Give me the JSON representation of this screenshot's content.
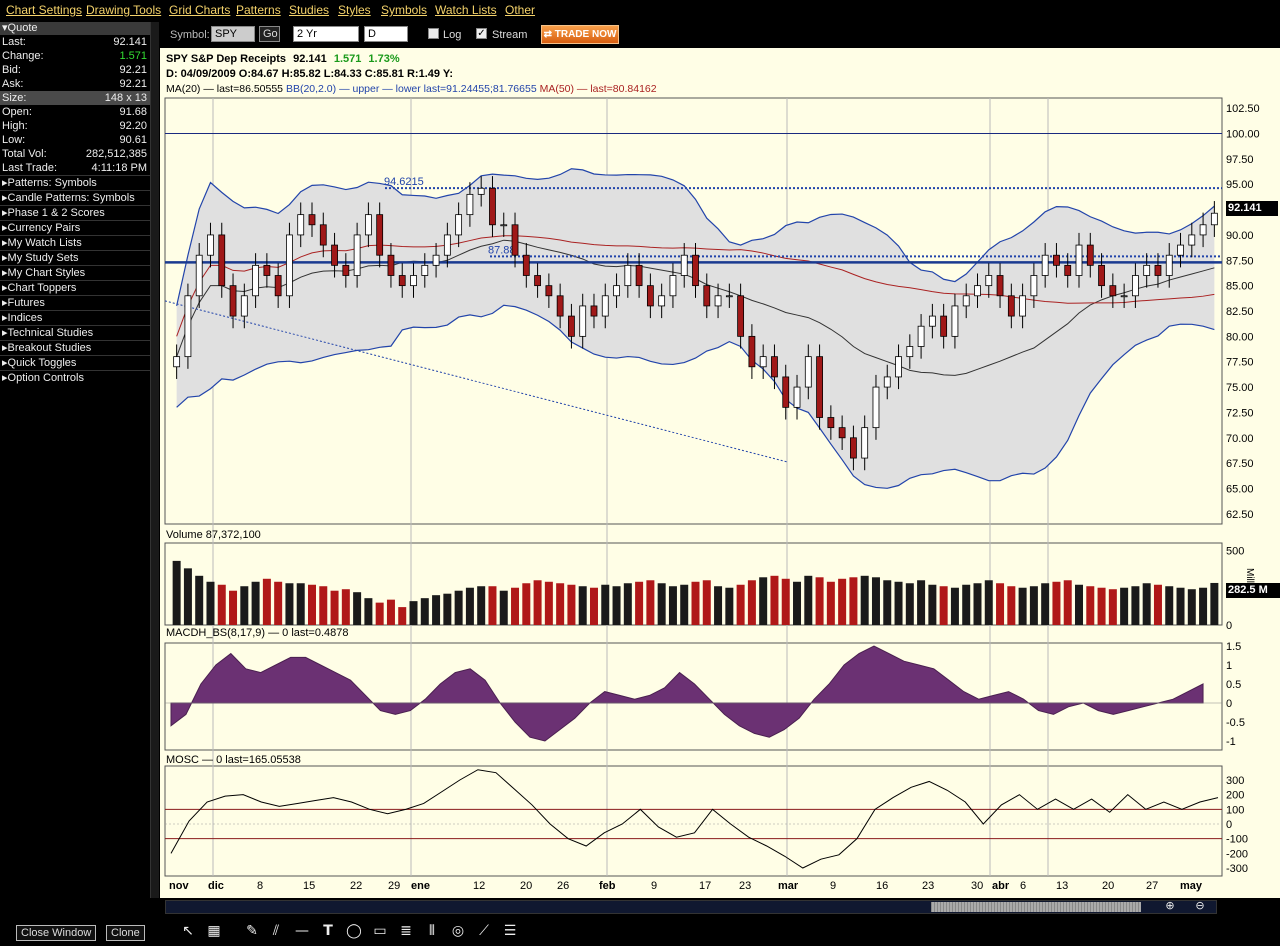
{
  "menu": [
    "Chart Settings",
    "Drawing Tools",
    "Grid Charts",
    "Patterns",
    "Studies",
    "Styles",
    "Symbols",
    "Watch Lists",
    "Other"
  ],
  "toolbar": {
    "symbol_label": "Symbol:",
    "symbol": "SPY",
    "go": "Go",
    "period": "2 Yr",
    "interval": "D",
    "log": "Log",
    "log_checked": false,
    "stream": "Stream",
    "stream_checked": true,
    "trade": "TRADE NOW"
  },
  "sidebar": {
    "header": "Quote",
    "quote": [
      {
        "k": "Last:",
        "v": "92.141"
      },
      {
        "k": "Change:",
        "v": "1.571",
        "color": "#33dd33"
      },
      {
        "k": "Bid:",
        "v": "92.21"
      },
      {
        "k": "Ask:",
        "v": "92.21"
      },
      {
        "k": "Size:",
        "v": "148 x 13"
      },
      {
        "k": "Open:",
        "v": "91.68"
      },
      {
        "k": "High:",
        "v": "92.20"
      },
      {
        "k": "Low:",
        "v": "90.61"
      },
      {
        "k": "Total Vol:",
        "v": "282,512,385"
      },
      {
        "k": "Last Trade:",
        "v": "4:11:18 PM"
      }
    ],
    "groups": [
      "Patterns: Symbols",
      "Candle Patterns: Symbols",
      "Phase 1 & 2 Scores",
      "Currency Pairs",
      "My Watch Lists",
      "My Study Sets",
      "My Chart Styles",
      "Chart Toppers",
      "Futures",
      "Indices",
      "Technical Studies",
      "Breakout Studies",
      "Quick Toggles",
      "Option Controls"
    ]
  },
  "chart": {
    "title": "SPY S&P Dep Receipts",
    "last": "92.141",
    "change": "1.571",
    "pct": "1.73%",
    "ohlc": {
      "date": "D: 04/09/2009",
      "o": "O:84.67",
      "h": "H:85.82",
      "l": "L:84.33",
      "c": "C:85.81",
      "r": "R:1.49",
      "y": "Y:"
    },
    "indicators": {
      "ma20": "MA(20) — last=86.50555",
      "bb": "BB(20,2.0) — upper — lower last=91.24455;81.76655",
      "ma50": "MA(50) — last=80.84162"
    },
    "last_badge": "92.141",
    "level_label_1": "94.6215",
    "level_label_2": "87.88",
    "volume_label": "Volume 87,372,100",
    "volume_badge": "282.5 M",
    "volume_unit": "Mill",
    "macd_label": "MACDH_BS(8,17,9) — 0 last=0.4878",
    "mosc_label": "MOSC — 0 last=165.05538",
    "x_labels": [
      "nov",
      "dic",
      "8",
      "15",
      "22",
      "29",
      "ene",
      "12",
      "20",
      "26",
      "feb",
      "9",
      "17",
      "23",
      "mar",
      "9",
      "16",
      "23",
      "30",
      "abr",
      "6",
      "13",
      "20",
      "27",
      "may"
    ]
  },
  "chart_data": {
    "type": "candlestick",
    "price_ylim": [
      61.5,
      103.5
    ],
    "price_ticks": [
      "102.50",
      "100.00",
      "97.50",
      "95.00",
      "92.50",
      "90.00",
      "87.50",
      "85.00",
      "82.50",
      "80.00",
      "77.50",
      "75.00",
      "72.50",
      "70.00",
      "67.50",
      "65.00",
      "62.50"
    ],
    "volume_ticks": [
      "500",
      "0"
    ],
    "macd_ticks": [
      "1.5",
      "1",
      "0.5",
      "0",
      "-0.5",
      "-1"
    ],
    "mosc_ticks": [
      "300",
      "200",
      "100",
      "0",
      "-100",
      "-200",
      "-300"
    ],
    "hlines": [
      100,
      94.62,
      87.88,
      87.3
    ],
    "closes": [
      78,
      84,
      88,
      90,
      85,
      82,
      84,
      87,
      86,
      84,
      90,
      92,
      91,
      89,
      87,
      86,
      90,
      92,
      88,
      86,
      85,
      86,
      87,
      88,
      90,
      92,
      94,
      94.6,
      91,
      91,
      88,
      86,
      85,
      84,
      82,
      80,
      83,
      82,
      84,
      85,
      87,
      85,
      83,
      84,
      86,
      88,
      85,
      83,
      84,
      84,
      80,
      77,
      78,
      76,
      73,
      75,
      78,
      72,
      71,
      70,
      68,
      71,
      75,
      76,
      78,
      79,
      81,
      82,
      80,
      83,
      84,
      85,
      86,
      84,
      82,
      84,
      86,
      88,
      87,
      86,
      89,
      87,
      85,
      84,
      84,
      86,
      87,
      86,
      88,
      89,
      90,
      91,
      92.14
    ],
    "volume": [
      430,
      380,
      330,
      290,
      270,
      230,
      260,
      290,
      310,
      290,
      280,
      280,
      270,
      260,
      230,
      240,
      220,
      180,
      150,
      170,
      120,
      160,
      180,
      200,
      210,
      230,
      250,
      260,
      260,
      230,
      250,
      280,
      300,
      290,
      280,
      270,
      260,
      250,
      270,
      260,
      280,
      290,
      300,
      280,
      260,
      270,
      290,
      300,
      260,
      250,
      270,
      300,
      320,
      330,
      310,
      290,
      330,
      320,
      290,
      310,
      320,
      330,
      320,
      300,
      290,
      280,
      300,
      270,
      260,
      250,
      270,
      280,
      300,
      280,
      260,
      250,
      260,
      280,
      290,
      300,
      270,
      260,
      250,
      240,
      250,
      260,
      280,
      270,
      260,
      250,
      240,
      250,
      282
    ],
    "macd": [
      -0.6,
      -0.3,
      0.5,
      1.0,
      1.3,
      0.9,
      0.8,
      1.0,
      1.2,
      1.2,
      1.0,
      0.8,
      0.6,
      0.2,
      -0.2,
      -0.3,
      -0.2,
      0.1,
      0.5,
      0.8,
      0.9,
      0.6,
      0.0,
      -0.5,
      -0.9,
      -1.0,
      -0.7,
      -0.4,
      0.0,
      0.3,
      0.2,
      0.1,
      0.2,
      0.4,
      0.8,
      0.5,
      0.1,
      -0.3,
      -0.6,
      -0.8,
      -0.9,
      -0.7,
      -0.4,
      0.1,
      0.5,
      1.0,
      1.3,
      1.5,
      1.3,
      1.1,
      1.0,
      0.9,
      0.6,
      0.3,
      0.1,
      0.2,
      0.3,
      0.1,
      -0.2,
      -0.3,
      -0.1,
      0.0,
      -0.2,
      -0.3,
      -0.2,
      -0.1,
      0.0,
      0.1,
      0.3,
      0.5
    ],
    "mosc": [
      -200,
      20,
      150,
      190,
      200,
      150,
      120,
      140,
      160,
      180,
      150,
      100,
      70,
      100,
      140,
      220,
      300,
      370,
      350,
      240,
      130,
      0,
      -100,
      -150,
      -60,
      0,
      100,
      -20,
      -90,
      -60,
      100,
      0,
      -90,
      -150,
      -220,
      -300,
      -240,
      -210,
      -100,
      100,
      180,
      250,
      290,
      230,
      150,
      0,
      130,
      200,
      100,
      170,
      100,
      170,
      80,
      200,
      100,
      150,
      100,
      150,
      180
    ]
  }
}
